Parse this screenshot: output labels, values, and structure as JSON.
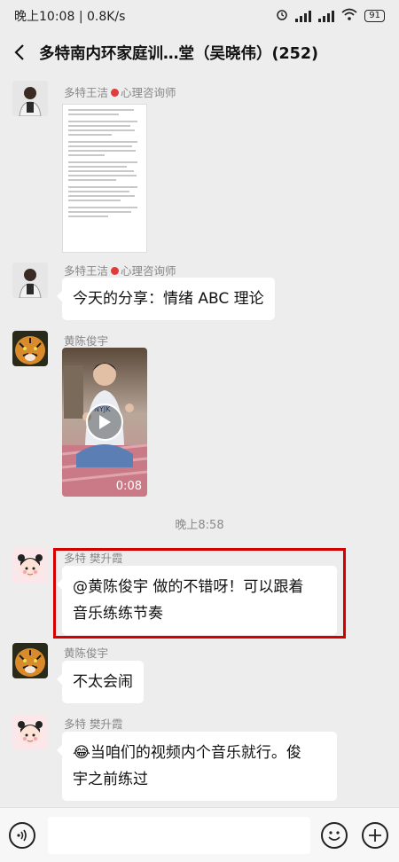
{
  "status_bar": {
    "time": "晚上10:08",
    "speed": "0.8K/s",
    "battery": "91"
  },
  "nav": {
    "title": "多特南内环家庭训…堂（吴晓伟）(252)"
  },
  "messages": [
    {
      "sender": "多特王洁",
      "sender_suffix": "心理咨询师",
      "type": "file"
    },
    {
      "sender": "多特王洁",
      "sender_suffix": "心理咨询师",
      "type": "text",
      "text": "今天的分享：情绪 ABC 理论"
    },
    {
      "sender": "黄陈俊宇",
      "type": "video",
      "duration": "0:08"
    },
    {
      "sender": "多特 樊升霞",
      "type": "text",
      "text_line1": "@黄陈俊宇  做的不错呀！可以跟着",
      "text_line2": "音乐练练节奏"
    },
    {
      "sender": "黄陈俊宇",
      "type": "text",
      "text": "不太会闹"
    },
    {
      "sender": "多特 樊升霞",
      "type": "text",
      "emoji": "😂",
      "text_line1": "当咱们的视频内个音乐就行。俊",
      "text_line2": "宇之前练过"
    }
  ],
  "timestamp": "晚上8:58",
  "input": {
    "placeholder": ""
  },
  "icons": {
    "back": "back-arrow-icon",
    "voice": "voice-icon",
    "emoji": "emoji-icon",
    "add": "plus-icon",
    "play": "play-icon"
  },
  "colors": {
    "background": "#ededed",
    "bubble": "#ffffff",
    "highlight": "#d40000",
    "pin": "#e23b3b"
  }
}
